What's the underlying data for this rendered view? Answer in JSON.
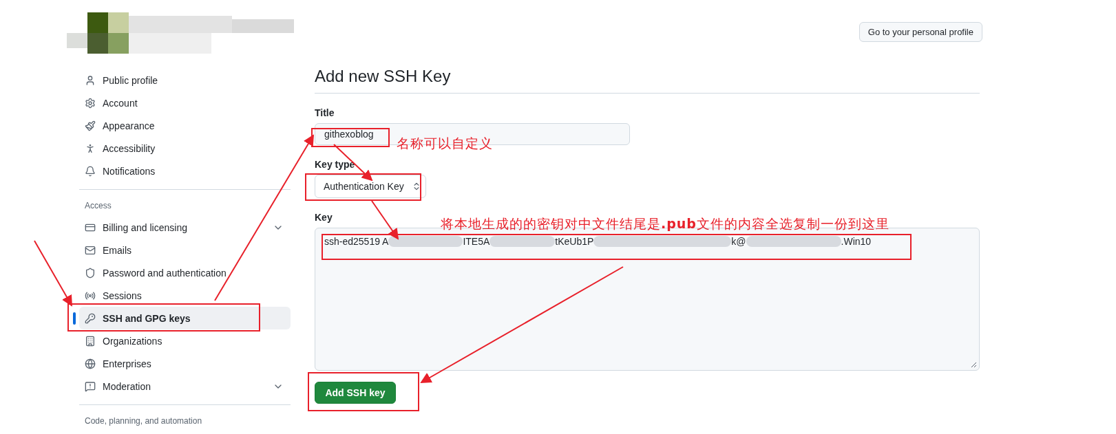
{
  "header_button": "Go to your personal profile",
  "sidebar": {
    "sections": [
      {
        "items": [
          {
            "label": "Public profile",
            "selected": false,
            "expandable": false
          },
          {
            "label": "Account",
            "selected": false,
            "expandable": false
          },
          {
            "label": "Appearance",
            "selected": false,
            "expandable": false
          },
          {
            "label": "Accessibility",
            "selected": false,
            "expandable": false
          },
          {
            "label": "Notifications",
            "selected": false,
            "expandable": false
          }
        ]
      },
      {
        "heading": "Access",
        "items": [
          {
            "label": "Billing and licensing",
            "selected": false,
            "expandable": true
          },
          {
            "label": "Emails",
            "selected": false,
            "expandable": false
          },
          {
            "label": "Password and authentication",
            "selected": false,
            "expandable": false
          },
          {
            "label": "Sessions",
            "selected": false,
            "expandable": false
          },
          {
            "label": "SSH and GPG keys",
            "selected": true,
            "expandable": false
          },
          {
            "label": "Organizations",
            "selected": false,
            "expandable": false
          },
          {
            "label": "Enterprises",
            "selected": false,
            "expandable": false
          },
          {
            "label": "Moderation",
            "selected": false,
            "expandable": true
          }
        ]
      },
      {
        "heading": "Code, planning, and automation"
      }
    ]
  },
  "form": {
    "heading": "Add new SSH Key",
    "title_label": "Title",
    "title_value": "githexoblog",
    "key_type_label": "Key type",
    "key_type_value": "Authentication Key",
    "key_label": "Key",
    "key_fragments": [
      "ssh-ed25519 A",
      "ITE5A",
      "tKeUb1P",
      "k@",
      ".Win10"
    ],
    "submit": "Add SSH key"
  },
  "annotations": [
    {
      "text": "名称可以自定义"
    },
    {
      "text": "将本地生成的的密钥对中文件结尾是**.pub**文件的内容全选复制一份到这里"
    }
  ]
}
